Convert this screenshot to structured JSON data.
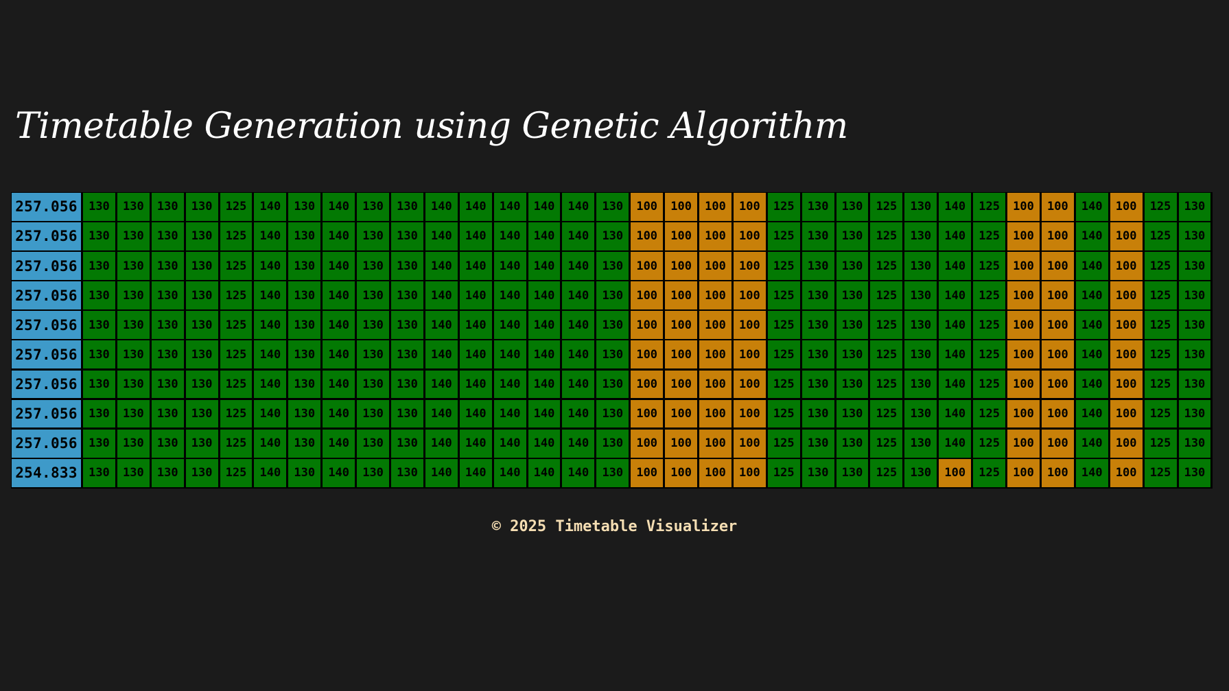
{
  "page": {
    "title": "Timetable Generation using Genetic Algorithm",
    "footer": "© 2025 Timetable Visualizer"
  },
  "colors": {
    "background": "#1b1b1b",
    "fitness": "#3e9ac9",
    "normal": "#037903",
    "conflict": "#c88009",
    "footer_text": "#f5deb3"
  },
  "rows": [
    {
      "fitness": "257.056",
      "values": [
        "130",
        "130",
        "130",
        "130",
        "125",
        "140",
        "130",
        "140",
        "130",
        "130",
        "140",
        "140",
        "140",
        "140",
        "140",
        "130",
        "100",
        "100",
        "100",
        "100",
        "125",
        "130",
        "130",
        "125",
        "130",
        "140",
        "125",
        "100",
        "100",
        "140",
        "100",
        "125",
        "130"
      ],
      "conflict": [
        0,
        0,
        0,
        0,
        0,
        0,
        0,
        0,
        0,
        0,
        0,
        0,
        0,
        0,
        0,
        0,
        1,
        1,
        1,
        1,
        0,
        0,
        0,
        0,
        0,
        0,
        0,
        1,
        1,
        0,
        1,
        0,
        0
      ]
    },
    {
      "fitness": "257.056",
      "values": [
        "130",
        "130",
        "130",
        "130",
        "125",
        "140",
        "130",
        "140",
        "130",
        "130",
        "140",
        "140",
        "140",
        "140",
        "140",
        "130",
        "100",
        "100",
        "100",
        "100",
        "125",
        "130",
        "130",
        "125",
        "130",
        "140",
        "125",
        "100",
        "100",
        "140",
        "100",
        "125",
        "130"
      ],
      "conflict": [
        0,
        0,
        0,
        0,
        0,
        0,
        0,
        0,
        0,
        0,
        0,
        0,
        0,
        0,
        0,
        0,
        1,
        1,
        1,
        1,
        0,
        0,
        0,
        0,
        0,
        0,
        0,
        1,
        1,
        0,
        1,
        0,
        0
      ]
    },
    {
      "fitness": "257.056",
      "values": [
        "130",
        "130",
        "130",
        "130",
        "125",
        "140",
        "130",
        "140",
        "130",
        "130",
        "140",
        "140",
        "140",
        "140",
        "140",
        "130",
        "100",
        "100",
        "100",
        "100",
        "125",
        "130",
        "130",
        "125",
        "130",
        "140",
        "125",
        "100",
        "100",
        "140",
        "100",
        "125",
        "130"
      ],
      "conflict": [
        0,
        0,
        0,
        0,
        0,
        0,
        0,
        0,
        0,
        0,
        0,
        0,
        0,
        0,
        0,
        0,
        1,
        1,
        1,
        1,
        0,
        0,
        0,
        0,
        0,
        0,
        0,
        1,
        1,
        0,
        1,
        0,
        0
      ]
    },
    {
      "fitness": "257.056",
      "values": [
        "130",
        "130",
        "130",
        "130",
        "125",
        "140",
        "130",
        "140",
        "130",
        "130",
        "140",
        "140",
        "140",
        "140",
        "140",
        "130",
        "100",
        "100",
        "100",
        "100",
        "125",
        "130",
        "130",
        "125",
        "130",
        "140",
        "125",
        "100",
        "100",
        "140",
        "100",
        "125",
        "130"
      ],
      "conflict": [
        0,
        0,
        0,
        0,
        0,
        0,
        0,
        0,
        0,
        0,
        0,
        0,
        0,
        0,
        0,
        0,
        1,
        1,
        1,
        1,
        0,
        0,
        0,
        0,
        0,
        0,
        0,
        1,
        1,
        0,
        1,
        0,
        0
      ]
    },
    {
      "fitness": "257.056",
      "values": [
        "130",
        "130",
        "130",
        "130",
        "125",
        "140",
        "130",
        "140",
        "130",
        "130",
        "140",
        "140",
        "140",
        "140",
        "140",
        "130",
        "100",
        "100",
        "100",
        "100",
        "125",
        "130",
        "130",
        "125",
        "130",
        "140",
        "125",
        "100",
        "100",
        "140",
        "100",
        "125",
        "130"
      ],
      "conflict": [
        0,
        0,
        0,
        0,
        0,
        0,
        0,
        0,
        0,
        0,
        0,
        0,
        0,
        0,
        0,
        0,
        1,
        1,
        1,
        1,
        0,
        0,
        0,
        0,
        0,
        0,
        0,
        1,
        1,
        0,
        1,
        0,
        0
      ]
    },
    {
      "fitness": "257.056",
      "values": [
        "130",
        "130",
        "130",
        "130",
        "125",
        "140",
        "130",
        "140",
        "130",
        "130",
        "140",
        "140",
        "140",
        "140",
        "140",
        "130",
        "100",
        "100",
        "100",
        "100",
        "125",
        "130",
        "130",
        "125",
        "130",
        "140",
        "125",
        "100",
        "100",
        "140",
        "100",
        "125",
        "130"
      ],
      "conflict": [
        0,
        0,
        0,
        0,
        0,
        0,
        0,
        0,
        0,
        0,
        0,
        0,
        0,
        0,
        0,
        0,
        1,
        1,
        1,
        1,
        0,
        0,
        0,
        0,
        0,
        0,
        0,
        1,
        1,
        0,
        1,
        0,
        0
      ]
    },
    {
      "fitness": "257.056",
      "values": [
        "130",
        "130",
        "130",
        "130",
        "125",
        "140",
        "130",
        "140",
        "130",
        "130",
        "140",
        "140",
        "140",
        "140",
        "140",
        "130",
        "100",
        "100",
        "100",
        "100",
        "125",
        "130",
        "130",
        "125",
        "130",
        "140",
        "125",
        "100",
        "100",
        "140",
        "100",
        "125",
        "130"
      ],
      "conflict": [
        0,
        0,
        0,
        0,
        0,
        0,
        0,
        0,
        0,
        0,
        0,
        0,
        0,
        0,
        0,
        0,
        1,
        1,
        1,
        1,
        0,
        0,
        0,
        0,
        0,
        0,
        0,
        1,
        1,
        0,
        1,
        0,
        0
      ]
    },
    {
      "fitness": "257.056",
      "values": [
        "130",
        "130",
        "130",
        "130",
        "125",
        "140",
        "130",
        "140",
        "130",
        "130",
        "140",
        "140",
        "140",
        "140",
        "140",
        "130",
        "100",
        "100",
        "100",
        "100",
        "125",
        "130",
        "130",
        "125",
        "130",
        "140",
        "125",
        "100",
        "100",
        "140",
        "100",
        "125",
        "130"
      ],
      "conflict": [
        0,
        0,
        0,
        0,
        0,
        0,
        0,
        0,
        0,
        0,
        0,
        0,
        0,
        0,
        0,
        0,
        1,
        1,
        1,
        1,
        0,
        0,
        0,
        0,
        0,
        0,
        0,
        1,
        1,
        0,
        1,
        0,
        0
      ]
    },
    {
      "fitness": "257.056",
      "values": [
        "130",
        "130",
        "130",
        "130",
        "125",
        "140",
        "130",
        "140",
        "130",
        "130",
        "140",
        "140",
        "140",
        "140",
        "140",
        "130",
        "100",
        "100",
        "100",
        "100",
        "125",
        "130",
        "130",
        "125",
        "130",
        "140",
        "125",
        "100",
        "100",
        "140",
        "100",
        "125",
        "130"
      ],
      "conflict": [
        0,
        0,
        0,
        0,
        0,
        0,
        0,
        0,
        0,
        0,
        0,
        0,
        0,
        0,
        0,
        0,
        1,
        1,
        1,
        1,
        0,
        0,
        0,
        0,
        0,
        0,
        0,
        1,
        1,
        0,
        1,
        0,
        0
      ]
    },
    {
      "fitness": "254.833",
      "values": [
        "130",
        "130",
        "130",
        "130",
        "125",
        "140",
        "130",
        "140",
        "130",
        "130",
        "140",
        "140",
        "140",
        "140",
        "140",
        "130",
        "100",
        "100",
        "100",
        "100",
        "125",
        "130",
        "130",
        "125",
        "130",
        "100",
        "125",
        "100",
        "100",
        "140",
        "100",
        "125",
        "130"
      ],
      "conflict": [
        0,
        0,
        0,
        0,
        0,
        0,
        0,
        0,
        0,
        0,
        0,
        0,
        0,
        0,
        0,
        0,
        1,
        1,
        1,
        1,
        0,
        0,
        0,
        0,
        0,
        1,
        0,
        1,
        1,
        0,
        1,
        0,
        0
      ]
    }
  ]
}
